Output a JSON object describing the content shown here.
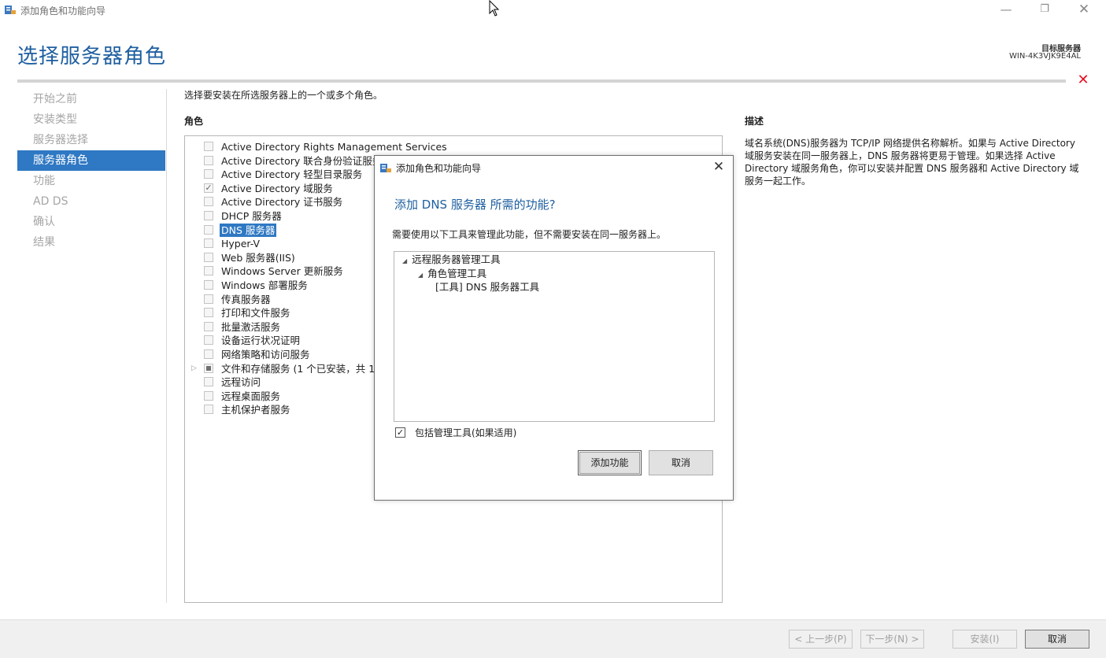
{
  "window": {
    "title": "添加角色和功能向导",
    "minimize": "—",
    "restore": "❐",
    "close": "✕"
  },
  "header": {
    "page_title": "选择服务器角色",
    "target_label": "目标服务器",
    "target_value": "WIN-4K3VJK9E4AL",
    "close_glyph": "✕"
  },
  "nav": {
    "items": [
      {
        "label": "开始之前",
        "active": false
      },
      {
        "label": "安装类型",
        "active": false
      },
      {
        "label": "服务器选择",
        "active": false
      },
      {
        "label": "服务器角色",
        "active": true
      },
      {
        "label": "功能",
        "active": false
      },
      {
        "label": "AD DS",
        "active": false
      },
      {
        "label": "确认",
        "active": false
      },
      {
        "label": "结果",
        "active": false
      }
    ]
  },
  "main": {
    "instruction": "选择要安装在所选服务器上的一个或多个角色。",
    "roles_header": "角色",
    "description_header": "描述",
    "description_text": "域名系统(DNS)服务器为 TCP/IP 网络提供名称解析。如果与 Active Directory 域服务安装在同一服务器上，DNS 服务器将更易于管理。如果选择 Active Directory 域服务角色，你可以安装并配置 DNS 服务器和 Active Directory 域服务一起工作。",
    "roles": [
      {
        "label": "Active Directory Rights Management Services",
        "state": "unchecked"
      },
      {
        "label": "Active Directory 联合身份验证服务",
        "state": "unchecked"
      },
      {
        "label": "Active Directory 轻型目录服务",
        "state": "unchecked"
      },
      {
        "label": "Active Directory 域服务",
        "state": "checked"
      },
      {
        "label": "Active Directory 证书服务",
        "state": "unchecked"
      },
      {
        "label": "DHCP 服务器",
        "state": "unchecked"
      },
      {
        "label": "DNS 服务器",
        "state": "unchecked",
        "selected": true
      },
      {
        "label": "Hyper-V",
        "state": "unchecked"
      },
      {
        "label": "Web 服务器(IIS)",
        "state": "unchecked"
      },
      {
        "label": "Windows Server 更新服务",
        "state": "unchecked"
      },
      {
        "label": "Windows 部署服务",
        "state": "unchecked"
      },
      {
        "label": "传真服务器",
        "state": "unchecked"
      },
      {
        "label": "打印和文件服务",
        "state": "unchecked"
      },
      {
        "label": "批量激活服务",
        "state": "unchecked"
      },
      {
        "label": "设备运行状况证明",
        "state": "unchecked"
      },
      {
        "label": "网络策略和访问服务",
        "state": "unchecked"
      },
      {
        "label": "文件和存储服务 (1 个已安装，共 12 个)",
        "state": "partial",
        "expandable": true
      },
      {
        "label": "远程访问",
        "state": "unchecked"
      },
      {
        "label": "远程桌面服务",
        "state": "unchecked"
      },
      {
        "label": "主机保护者服务",
        "state": "unchecked"
      }
    ]
  },
  "footer": {
    "prev": "< 上一步(P)",
    "next": "下一步(N) >",
    "install": "安装(I)",
    "cancel": "取消"
  },
  "dialog": {
    "title": "添加角色和功能向导",
    "close": "✕",
    "heading": "添加 DNS 服务器 所需的功能?",
    "description": "需要使用以下工具来管理此功能，但不需要安装在同一服务器上。",
    "tree": [
      {
        "label": "远程服务器管理工具",
        "level": 0,
        "expanded": true
      },
      {
        "label": "角色管理工具",
        "level": 1,
        "expanded": true
      },
      {
        "label": "[工具] DNS 服务器工具",
        "level": 2
      }
    ],
    "include_tools_label": "包括管理工具(如果适用)",
    "include_tools_checked": true,
    "add_button": "添加功能",
    "cancel_button": "取消"
  }
}
